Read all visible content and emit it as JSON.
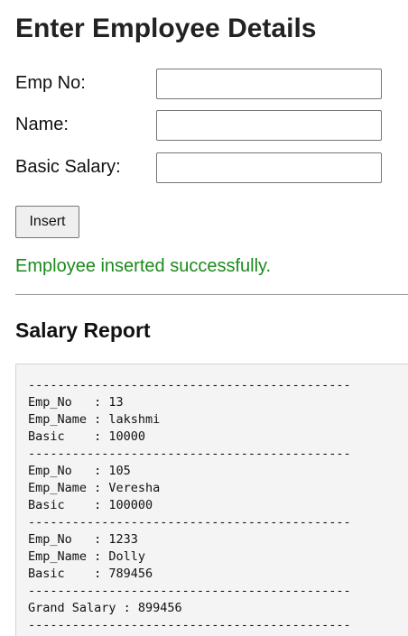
{
  "page": {
    "title": "Enter Employee Details"
  },
  "form": {
    "emp_no": {
      "label": "Emp No:",
      "value": "",
      "placeholder": ""
    },
    "name": {
      "label": "Name:",
      "value": "",
      "placeholder": ""
    },
    "basic_salary": {
      "label": "Basic Salary:",
      "value": "",
      "placeholder": ""
    },
    "insert_label": "Insert"
  },
  "status": {
    "message": "Employee inserted successfully.",
    "color": "#1a8a1a"
  },
  "report": {
    "title": "Salary Report",
    "lines": [
      "--------------------------------------------",
      "Emp_No   : 13",
      "Emp_Name : lakshmi",
      "Basic    : 10000",
      "--------------------------------------------",
      "Emp_No   : 105",
      "Emp_Name : Veresha",
      "Basic    : 100000",
      "--------------------------------------------",
      "Emp_No   : 1233",
      "Emp_Name : Dolly",
      "Basic    : 789456",
      "--------------------------------------------",
      "Grand Salary : 899456",
      "--------------------------------------------"
    ]
  }
}
